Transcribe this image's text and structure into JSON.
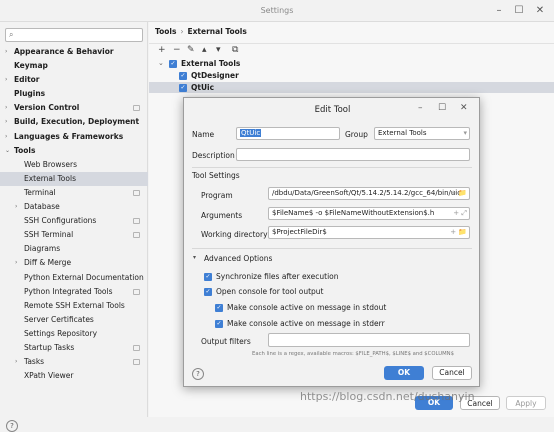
{
  "window": {
    "title": "Settings",
    "minimize": "–",
    "maximize": "☐",
    "close": "✕"
  },
  "sidebar": {
    "search_placeholder": "",
    "items": [
      {
        "label": "Appearance & Behavior",
        "bold": true,
        "arrow": "›",
        "level": 0,
        "proj": false
      },
      {
        "label": "Keymap",
        "bold": true,
        "arrow": "",
        "level": 0,
        "proj": false
      },
      {
        "label": "Editor",
        "bold": true,
        "arrow": "›",
        "level": 0,
        "proj": false
      },
      {
        "label": "Plugins",
        "bold": true,
        "arrow": "",
        "level": 0,
        "proj": false
      },
      {
        "label": "Version Control",
        "bold": true,
        "arrow": "›",
        "level": 0,
        "proj": true
      },
      {
        "label": "Build, Execution, Deployment",
        "bold": true,
        "arrow": "›",
        "level": 0,
        "proj": false
      },
      {
        "label": "Languages & Frameworks",
        "bold": true,
        "arrow": "›",
        "level": 0,
        "proj": false
      },
      {
        "label": "Tools",
        "bold": true,
        "arrow": "⌄",
        "level": 0,
        "proj": false
      },
      {
        "label": "Web Browsers",
        "bold": false,
        "arrow": "",
        "level": 1,
        "proj": false
      },
      {
        "label": "External Tools",
        "bold": false,
        "arrow": "",
        "level": 1,
        "proj": false,
        "selected": true
      },
      {
        "label": "Terminal",
        "bold": false,
        "arrow": "",
        "level": 1,
        "proj": true
      },
      {
        "label": "Database",
        "bold": false,
        "arrow": "›",
        "level": 1,
        "proj": false
      },
      {
        "label": "SSH Configurations",
        "bold": false,
        "arrow": "",
        "level": 1,
        "proj": true
      },
      {
        "label": "SSH Terminal",
        "bold": false,
        "arrow": "",
        "level": 1,
        "proj": true
      },
      {
        "label": "Diagrams",
        "bold": false,
        "arrow": "",
        "level": 1,
        "proj": false
      },
      {
        "label": "Diff & Merge",
        "bold": false,
        "arrow": "›",
        "level": 1,
        "proj": false
      },
      {
        "label": "Python External Documentation",
        "bold": false,
        "arrow": "",
        "level": 1,
        "proj": false
      },
      {
        "label": "Python Integrated Tools",
        "bold": false,
        "arrow": "",
        "level": 1,
        "proj": true
      },
      {
        "label": "Remote SSH External Tools",
        "bold": false,
        "arrow": "",
        "level": 1,
        "proj": false
      },
      {
        "label": "Server Certificates",
        "bold": false,
        "arrow": "",
        "level": 1,
        "proj": false
      },
      {
        "label": "Settings Repository",
        "bold": false,
        "arrow": "",
        "level": 1,
        "proj": false
      },
      {
        "label": "Startup Tasks",
        "bold": false,
        "arrow": "",
        "level": 1,
        "proj": true
      },
      {
        "label": "Tasks",
        "bold": false,
        "arrow": "›",
        "level": 1,
        "proj": true
      },
      {
        "label": "XPath Viewer",
        "bold": false,
        "arrow": "",
        "level": 1,
        "proj": false
      }
    ],
    "help": "?"
  },
  "main": {
    "breadcrumb": [
      "Tools",
      "›",
      "External Tools"
    ],
    "toolbar": [
      "+",
      "−",
      "✎",
      "▴",
      "▾",
      "⧉"
    ],
    "tree": [
      {
        "label": "External Tools",
        "arrow": "⌄",
        "check": "✓"
      },
      {
        "label": "QtDesigner",
        "arrow": "",
        "check": "✓"
      },
      {
        "label": "QtUic",
        "arrow": "",
        "check": "✓",
        "selected": true
      }
    ]
  },
  "dialog": {
    "title": "Edit Tool",
    "name_label": "Name",
    "name_value": "QtUic",
    "group_label": "Group",
    "group_value": "External Tools",
    "description_label": "Description",
    "description_value": "",
    "tool_settings_label": "Tool Settings",
    "program_label": "Program",
    "program_value": "/dbdu/Data/GreenSoft/Qt/5.14.2/5.14.2/gcc_64/bin/uic",
    "arguments_label": "Arguments",
    "arguments_value": "$FileName$ -o $FileNameWithoutExtension$.h",
    "workdir_label": "Working directory",
    "workdir_value": "$ProjectFileDir$",
    "advanced_label": "Advanced Options",
    "checks": [
      {
        "label": "Synchronize files after execution",
        "indent": 0
      },
      {
        "label": "Open console for tool output",
        "indent": 0
      },
      {
        "label": "Make console active on message in stdout",
        "indent": 1
      },
      {
        "label": "Make console active on message in stderr",
        "indent": 1
      }
    ],
    "output_filters_label": "Output filters",
    "output_filters_value": "",
    "hint": "Each line is a regex, available macros: $FILE_PATH$, $LINE$ and $COLUMN$",
    "ok": "OK",
    "cancel": "Cancel",
    "help": "?"
  },
  "bottom": {
    "ok": "OK",
    "cancel": "Cancel",
    "apply": "Apply"
  },
  "watermark": "https://blog.csdn.net/dushanyin",
  "colors": {
    "accent": "#3f7fd4",
    "selection": "#d5d8df",
    "background": "#f2f2f2"
  }
}
